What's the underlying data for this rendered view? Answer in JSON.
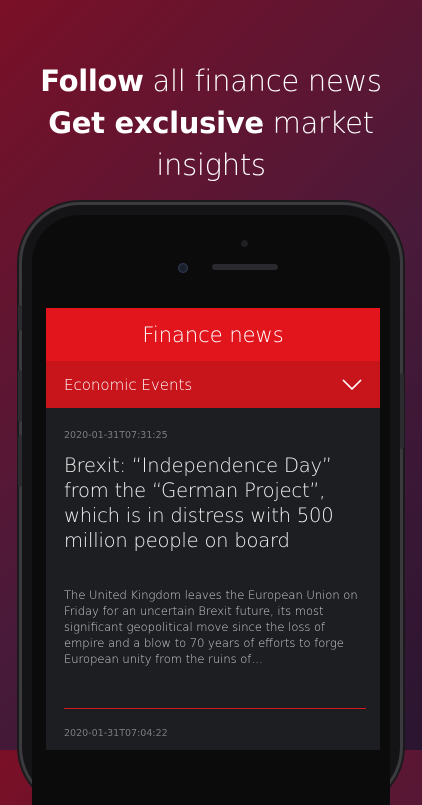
{
  "promo": {
    "line1_bold": "Follow",
    "line1_rest": " all finance news",
    "line2_bold": "Get exclusive",
    "line2_rest": " market",
    "line3": "insights"
  },
  "app": {
    "header_title": "Finance news",
    "category": {
      "selected": "Economic Events",
      "icon": "chevron-down-icon"
    }
  },
  "articles": [
    {
      "timestamp": "2020-01-31T07:31:25",
      "title": "Brexit: “Independence Day” from the “German Project”, which is in distress with 500 million people on board",
      "summary": "The United Kingdom leaves the European Union on Friday for an uncertain Brexit future, its most significant geopolitical move since the loss of empire and a blow to 70 years of efforts to forge European unity from the ruins of…"
    },
    {
      "timestamp": "2020-01-31T07:04:22"
    }
  ],
  "colors": {
    "accent": "#e3151c",
    "category_bar": "#c8141b",
    "screen_bg": "#1d1e22"
  }
}
